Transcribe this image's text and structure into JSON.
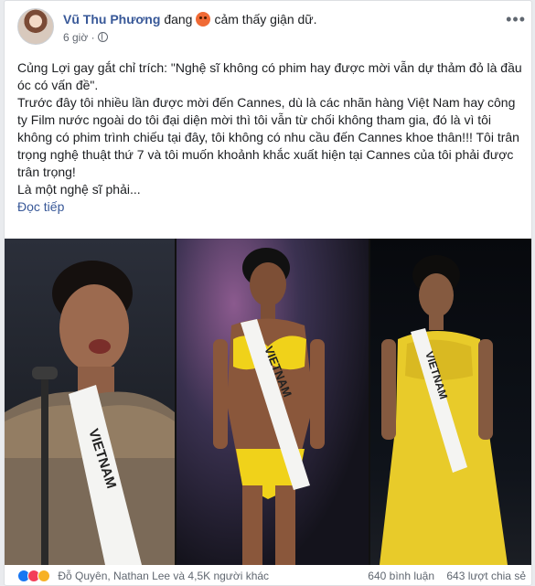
{
  "post": {
    "author": "Vũ Thu Phương",
    "feeling_prefix": "đang",
    "feeling": "cảm thấy giận dữ.",
    "time": "6 giờ",
    "paragraphs": [
      "Củng Lợi gay gắt chỉ trích: \"Nghệ sĩ không có phim hay được mời vẫn dự thảm đỏ là đầu óc có vấn đề\".",
      "Trước đây tôi nhiều lần được mời đến Cannes, dù là các nhãn hàng Việt Nam hay công ty Film nước ngoài do tôi đại diện mời thì tôi vẫn từ chối không tham gia, đó là vì tôi không có phim trình chiếu tại đây, tôi không có nhu cầu đến Cannes khoe thân!!! Tôi trân trọng nghệ thuật thứ 7 và tôi muốn khoảnh khắc xuất hiện tại Cannes của tôi phải được trân trọng!",
      "Là một nghệ sĩ phải..."
    ],
    "read_more": "Đọc tiếp"
  },
  "photos": {
    "sash_text": "VIETNAM"
  },
  "footer": {
    "reactions": [
      "like-icon",
      "love-icon",
      "haha-icon"
    ],
    "reactors": "Đỗ Quyên, Nathan Lee và 4,5K người khác",
    "comments": "640 bình luận",
    "shares": "643 lượt chia sẻ"
  }
}
